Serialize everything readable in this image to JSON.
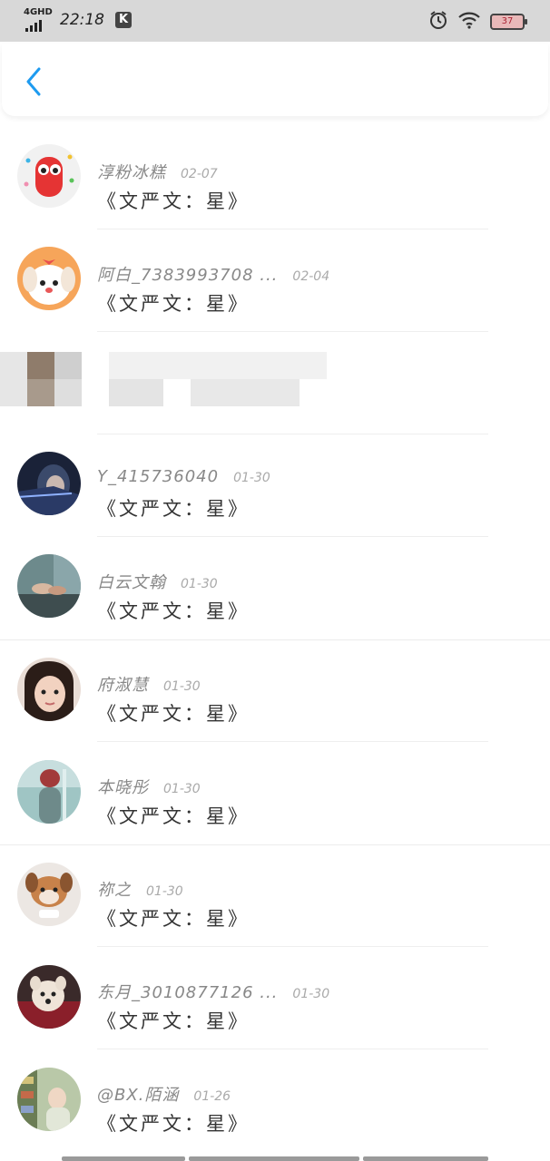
{
  "status_bar": {
    "network": "4GHD",
    "time": "22:18",
    "app_badge": "K",
    "battery": "37",
    "icons": [
      "signal-icon",
      "alarm-icon",
      "wifi-icon",
      "battery-icon"
    ]
  },
  "header": {
    "back_icon": "chevron-left-icon"
  },
  "comments": [
    {
      "name": "淳粉冰糕",
      "date": "02-07",
      "text": "《文严文：星》"
    },
    {
      "name": "阿白_7383993708 ...",
      "date": "02-04",
      "text": "《文严文：星》"
    },
    {
      "name": "",
      "date": "",
      "text": "",
      "blurred": true
    },
    {
      "name": "Y_415736040",
      "date": "01-30",
      "text": "《文严文：星》"
    },
    {
      "name": "白云文翰",
      "date": "01-30",
      "text": "《文严文：星》"
    },
    {
      "name": "府淑慧",
      "date": "01-30",
      "text": "《文严文：星》"
    },
    {
      "name": "本晓彤",
      "date": "01-30",
      "text": "《文严文：星》"
    },
    {
      "name": "祢之",
      "date": "01-30",
      "text": "《文严文：星》"
    },
    {
      "name": "东月_3010877126 ...",
      "date": "01-30",
      "text": "《文严文：星》"
    },
    {
      "name": "@BX.陌涵",
      "date": "01-26",
      "text": "《文严文：星》"
    }
  ],
  "colors": {
    "accent": "#1e9bf0",
    "status_bar_bg": "#d8d8d8"
  }
}
